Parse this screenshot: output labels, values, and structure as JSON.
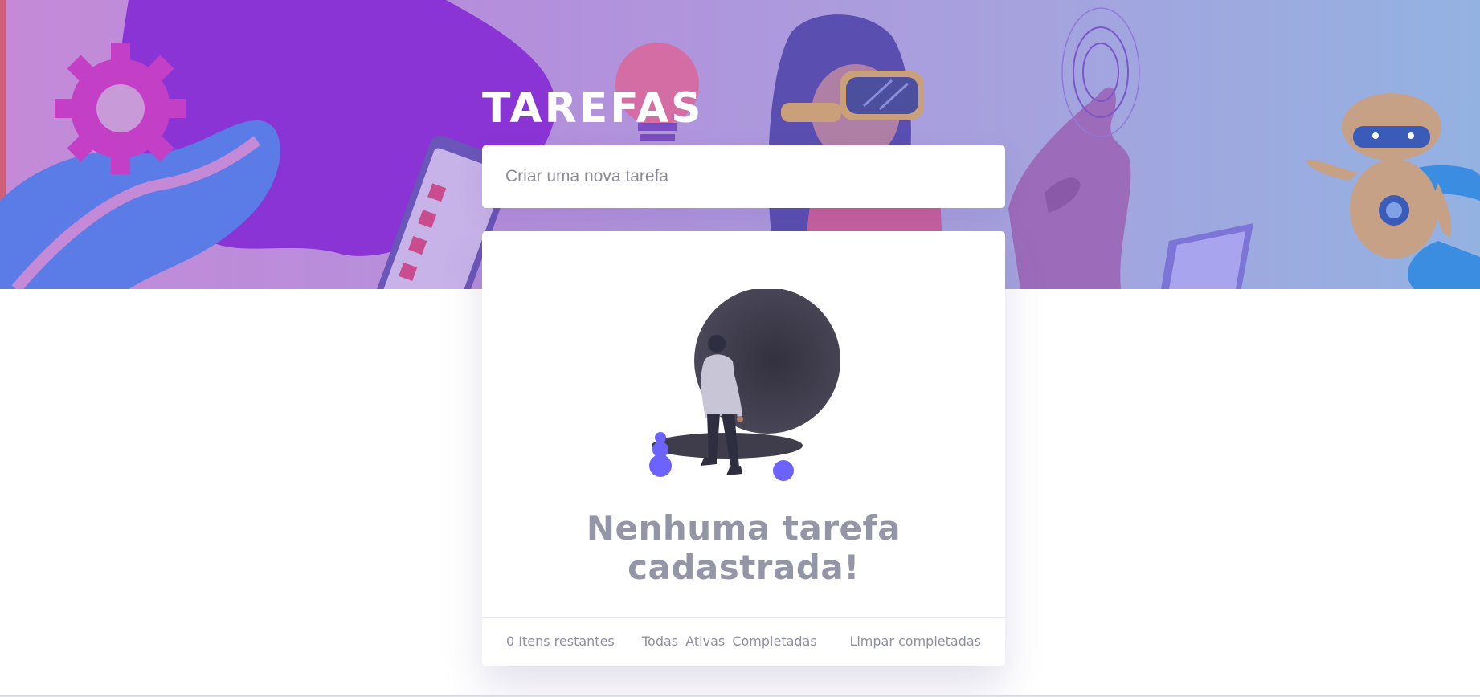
{
  "app": {
    "title": "TAREFAS"
  },
  "new_task": {
    "placeholder": "Criar uma nova tarefa",
    "value": ""
  },
  "empty_state": {
    "message": "Nenhuma tarefa cadastrada!"
  },
  "footer": {
    "items_left": "0 Itens restantes",
    "filters": [
      "Todas",
      "Ativas",
      "Completadas"
    ],
    "clear_label": "Limpar completadas"
  },
  "colors": {
    "text_muted": "#9495a6",
    "accent": "#6c63ff",
    "hero_start": "#c48ad8",
    "hero_end": "#93b2e2"
  },
  "icons": [
    "gear-icon",
    "lightbulb-icon",
    "vr-headset-icon",
    "phone-icon",
    "robot-icon",
    "laptop-icon",
    "fingerprint-icon"
  ]
}
